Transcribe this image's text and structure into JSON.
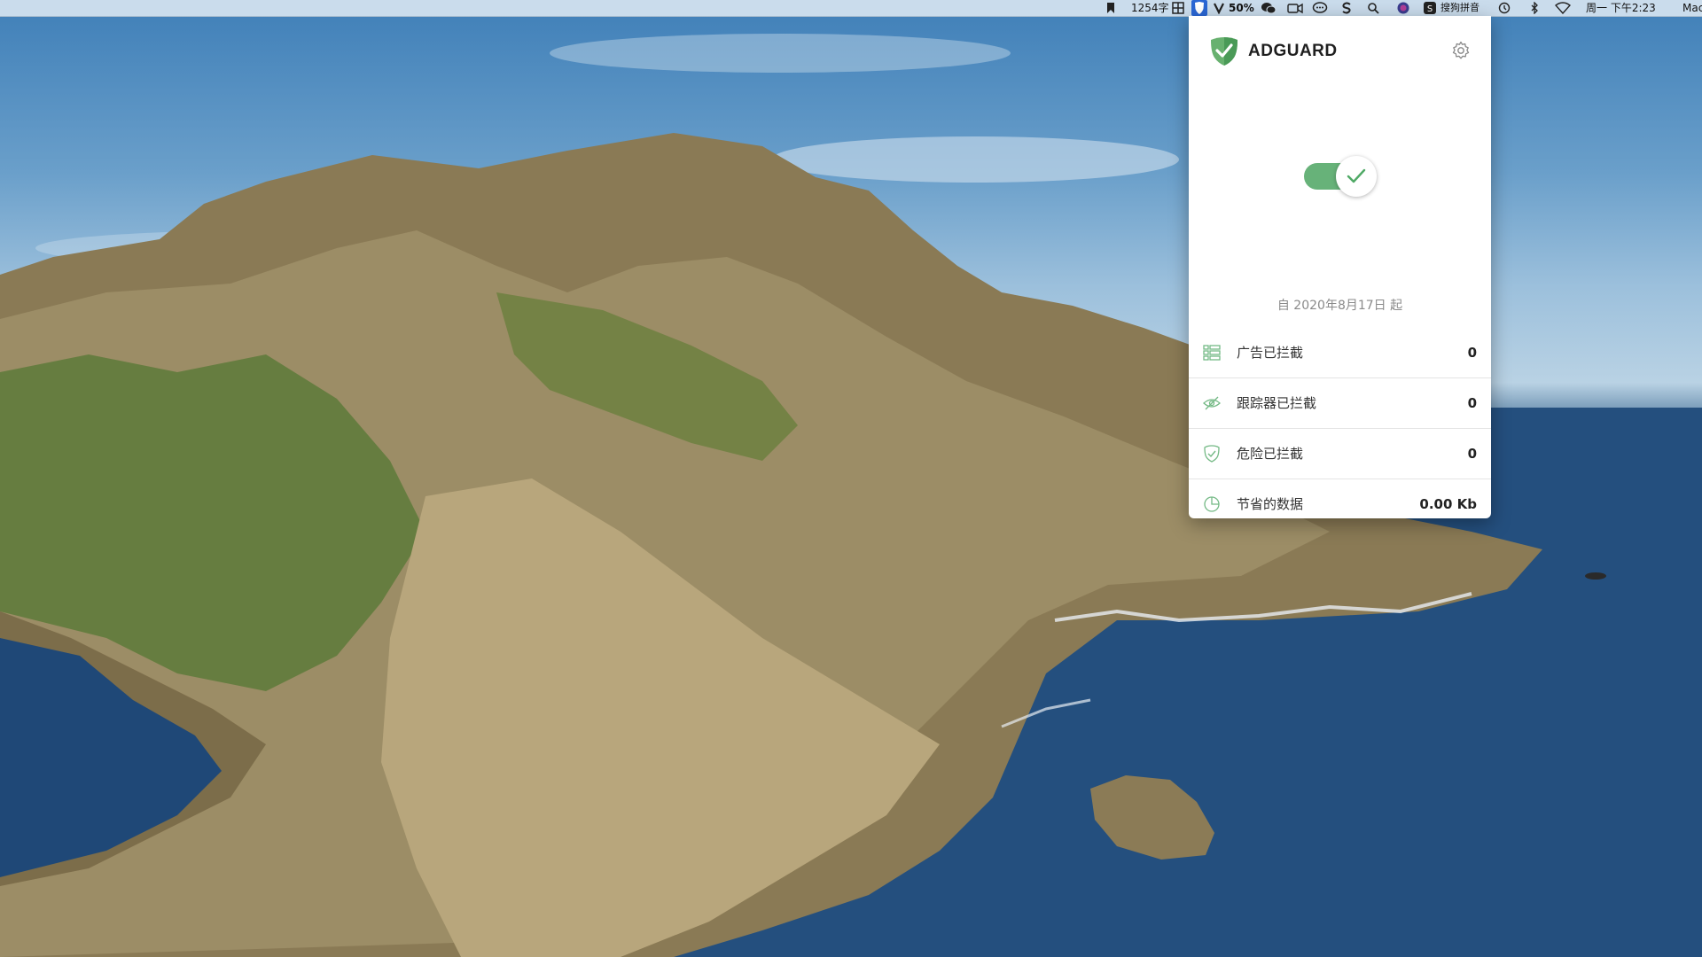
{
  "menubar": {
    "word_count": "1254字",
    "battery_text": "50%",
    "ime_label": "搜狗拼音",
    "clock": "周一 下午2:23",
    "user_fragment": "Mac",
    "icons": [
      "bookmark-icon",
      "grid-icon",
      "adguard-menu-icon",
      "vpn-icon",
      "wechat-icon",
      "facetime-icon",
      "messages-icon",
      "s-app-icon",
      "spotlight-icon",
      "siri-icon",
      "sogou-icon",
      "timemachine-icon",
      "bluetooth-icon",
      "wifi-icon"
    ]
  },
  "popover": {
    "brand": "ADGUARD",
    "brand_color": "#2f9e5a",
    "toggle_on": true,
    "since_text": "自 2020年8月17日 起",
    "stats": [
      {
        "icon": "ads-list-icon",
        "label": "广告已拦截",
        "value": "0"
      },
      {
        "icon": "tracker-eye-icon",
        "label": "跟踪器已拦截",
        "value": "0"
      },
      {
        "icon": "shield-check-icon",
        "label": "危险已拦截",
        "value": "0"
      },
      {
        "icon": "pie-chart-icon",
        "label": "节省的数据",
        "value": "0.00 Kb"
      }
    ]
  }
}
